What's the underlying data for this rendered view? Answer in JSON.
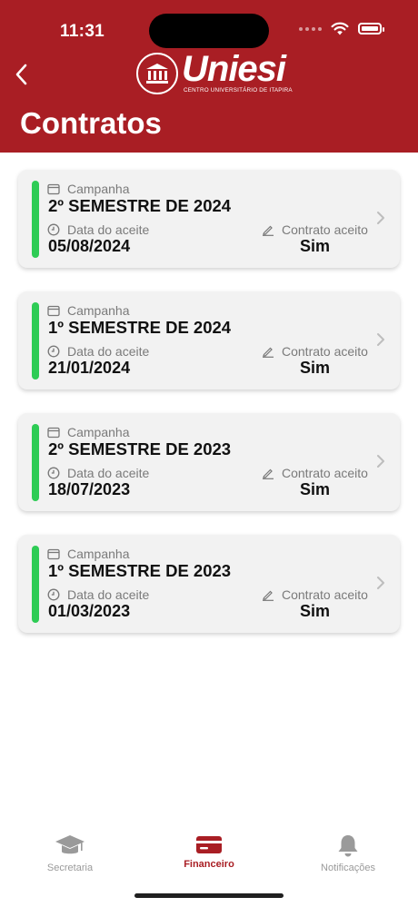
{
  "status_bar": {
    "time": "11:31"
  },
  "header": {
    "logo_name": "Uniesi",
    "logo_subtitle": "CENTRO UNIVERSITÁRIO DE ITAPIRA",
    "title": "Contratos",
    "back_icon": "chevron-left-icon"
  },
  "labels": {
    "campaign": "Campanha",
    "accept_date": "Data do aceite",
    "contract_accepted": "Contrato aceito"
  },
  "contracts": [
    {
      "campaign": "2º SEMESTRE DE 2024",
      "accept_date": "05/08/2024",
      "accepted": "Sim"
    },
    {
      "campaign": "1º SEMESTRE DE 2024",
      "accept_date": "21/01/2024",
      "accepted": "Sim"
    },
    {
      "campaign": "2º SEMESTRE DE 2023",
      "accept_date": "18/07/2023",
      "accepted": "Sim"
    },
    {
      "campaign": "1º SEMESTRE DE 2023",
      "accept_date": "01/03/2023",
      "accepted": "Sim"
    }
  ],
  "tabs": [
    {
      "label": "Secretaria",
      "icon": "graduation-cap-icon",
      "active": false
    },
    {
      "label": "Financeiro",
      "icon": "credit-card-icon",
      "active": true
    },
    {
      "label": "Notificações",
      "icon": "bell-icon",
      "active": false
    }
  ],
  "colors": {
    "brand": "#a91e24",
    "status_accent": "#2ecc55",
    "card_bg": "#f2f2f2"
  }
}
